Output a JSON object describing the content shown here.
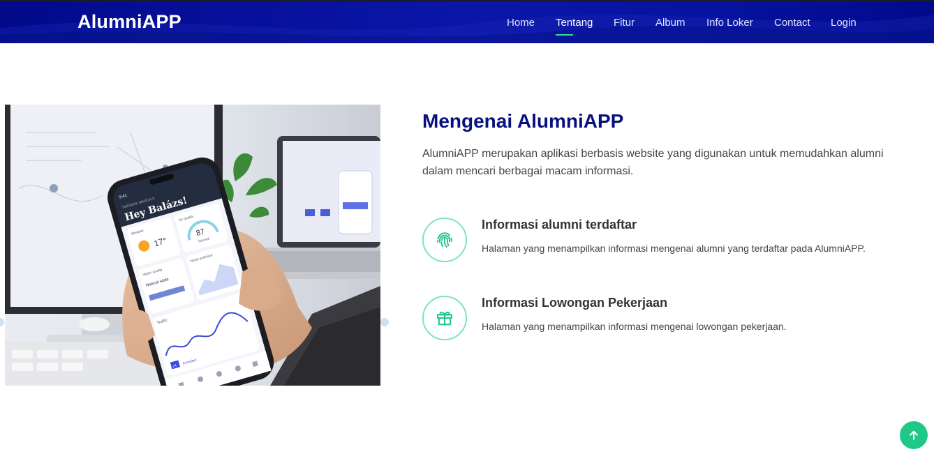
{
  "header": {
    "logo": "AlumniAPP",
    "nav": [
      {
        "label": "Home",
        "active": false
      },
      {
        "label": "Tentang",
        "active": true
      },
      {
        "label": "Fitur",
        "active": false
      },
      {
        "label": "Album",
        "active": false
      },
      {
        "label": "Info Loker",
        "active": false
      },
      {
        "label": "Contact",
        "active": false
      },
      {
        "label": "Login",
        "active": false
      }
    ]
  },
  "about": {
    "title": "Mengenai AlumniAPP",
    "description": "AlumniAPP merupakan aplikasi berbasis website yang digunakan untuk memudahkan alumni dalam mencari berbagai macam informasi.",
    "features": [
      {
        "icon": "fingerprint-icon",
        "title": "Informasi alumni terdaftar",
        "text": "Halaman yang menampilkan informasi mengenai alumni yang terdaftar pada AlumniAPP."
      },
      {
        "icon": "gift-icon",
        "title": "Informasi Lowongan Pekerjaan",
        "text": "Halaman yang menampilkan informasi mengenai lowongan pekerjaan."
      }
    ]
  },
  "photo": {
    "phone_greeting": "Hey Balázs!",
    "phone_date": "TUESDAY, MARCH 3",
    "weather_label": "Weather",
    "temperature": "17°",
    "air_quality_label": "Air quality",
    "air_quality_value": "87",
    "air_quality_status": "Normal",
    "water_quality_label": "Water quality",
    "water_quality_status": "Natural state",
    "noise_label": "Noise pollution",
    "traffic_label": "Traffic",
    "traffic_status": "Crowded",
    "traffic_badge": "24",
    "time": "9:41"
  },
  "colors": {
    "header": "#020a8a",
    "title": "#08107f",
    "accent": "#1ec988",
    "icon_ring": "#7ae3c1"
  },
  "back_to_top_icon": "arrow-up-icon"
}
